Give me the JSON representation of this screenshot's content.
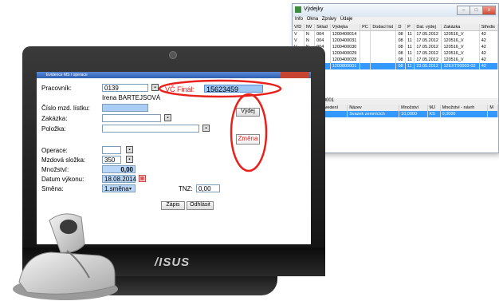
{
  "background_window": {
    "title": "Výdejky",
    "menu": [
      "Info",
      "Okna",
      "Zprávy",
      "Údaje"
    ],
    "columns": [
      "V/D",
      "NV",
      "Sklad",
      "Výdejka",
      "PC",
      "Dodací list",
      "D",
      "P",
      "Dat. výdej",
      "Zakázka",
      "Středis"
    ],
    "rows": [
      [
        "V",
        "N",
        "004",
        "1200400014",
        "",
        "",
        "08",
        "11",
        "17.05.2012",
        "120516_V",
        "42"
      ],
      [
        "V",
        "N",
        "004",
        "1200400031",
        "",
        "",
        "08",
        "11",
        "17.05.2012",
        "120516_V",
        "42"
      ],
      [
        "V",
        "N",
        "004",
        "1200400030",
        "",
        "",
        "08",
        "11",
        "17.05.2012",
        "120516_V",
        "42"
      ],
      [
        "",
        "",
        "",
        "1200400029",
        "",
        "",
        "08",
        "11",
        "17.05.2012",
        "120516_V",
        "42"
      ],
      [
        "",
        "",
        "",
        "1200400028",
        "",
        "",
        "08",
        "11",
        "17.05.2012",
        "120516_V",
        "42"
      ],
      [
        "",
        "",
        "",
        "1200800001",
        "",
        "",
        "08",
        "11",
        "23.05.2012",
        "12EXT00003-02",
        "42"
      ]
    ],
    "sub_bar": "000001",
    "sub_columns": [
      "Provedení",
      "Název",
      "Množství",
      "MJ",
      "Množství - návrh",
      "M"
    ],
    "sub_rows": [
      [
        "S",
        "Svazek zemnících",
        "10,0000",
        "KS",
        "0,0000",
        ""
      ]
    ]
  },
  "app": {
    "title": "Evidence MS / operace",
    "fields": {
      "pracovnik_label": "Pracovník:",
      "pracovnik_value": "0139",
      "pracovnik_name": "Irena BARTEJSOVÁ",
      "vc_final_label": "VČ Finál:",
      "vc_final_value": "15623459",
      "cislo_label": "Číslo mzd. lístku:",
      "zakazka_label": "Zakázka:",
      "polozka_label": "Položka:",
      "operace_label": "Operace:",
      "mzdova_label": "Mzdová složka:",
      "mzdova_value": "350",
      "mnozstvi_label": "Množství:",
      "mnozstvi_value": "0,00",
      "datum_label": "Datum výkonu:",
      "datum_value": "18.08.2014",
      "smena_label": "Směna:",
      "smena_value": "1.směna",
      "tnz_label": "TNZ:",
      "tnz_value": "0,00"
    },
    "buttons": {
      "vydej": "Výdej",
      "zmena": "Změna",
      "zapis": "Zápis",
      "odhlasit": "Odhlásit"
    }
  },
  "brand": "/ISUS",
  "colors": {
    "highlight": "#e8211d",
    "selection": "#3399ff",
    "field_blue": "#9cc7f5"
  }
}
